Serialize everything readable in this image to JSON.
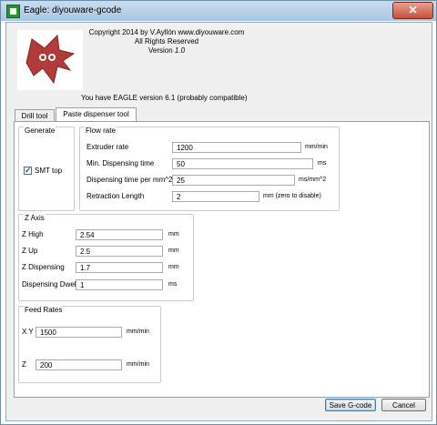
{
  "window": {
    "title": "Eagle: diyouware-gcode",
    "close_symbol": "✕"
  },
  "header": {
    "copyright": "Copyright 2014 by V.Ayllón www.diyouware.com",
    "rights": "All Rights Reserved",
    "version_label": "Version",
    "version_number": "1.0",
    "eagle_version": "You have EAGLE version 6.1 (probably compatible)"
  },
  "tabs": {
    "drill": "Drill tool",
    "paste": "Paste dispenser tool"
  },
  "generate": {
    "legend": "Generate",
    "smt_label": "SMT top",
    "smt_checked": true
  },
  "flow_rate": {
    "legend": "Flow rate",
    "extruder_rate": {
      "label": "Extruder rate",
      "value": "1200",
      "unit": "mm/min"
    },
    "min_dispensing_time": {
      "label": "Min. Dispensing time",
      "value": "50",
      "unit": "ms"
    },
    "dispensing_time_per_mm2": {
      "label": "Dispensing time per mm^2",
      "value": "25",
      "unit": "ms/mm^2"
    },
    "retraction_length": {
      "label": "Retraction Length",
      "value": "2",
      "unit": "mm  (zero to disable)"
    }
  },
  "z_axis": {
    "legend": "Z Axis",
    "z_high": {
      "label": "Z High",
      "value": "2.54",
      "unit": "mm"
    },
    "z_up": {
      "label": "Z Up",
      "value": "2.5",
      "unit": "mm"
    },
    "z_dispensing": {
      "label": "Z Dispensing",
      "value": "1.7",
      "unit": "mm"
    },
    "dispensing_dwell": {
      "label": "Dispensing Dwell",
      "value": "1",
      "unit": "ms"
    }
  },
  "feed_rates": {
    "legend": "Feed Rates",
    "xy": {
      "label": "X Y",
      "value": "1500",
      "unit": "mm/min"
    },
    "z": {
      "label": "Z",
      "value": "200",
      "unit": "mm/min"
    }
  },
  "buttons": {
    "save": "Save G-code",
    "cancel": "Cancel"
  },
  "colors": {
    "logo_red": "#b13a3a",
    "title_bar": "#b9d3ea",
    "close_button": "#c9503a"
  }
}
